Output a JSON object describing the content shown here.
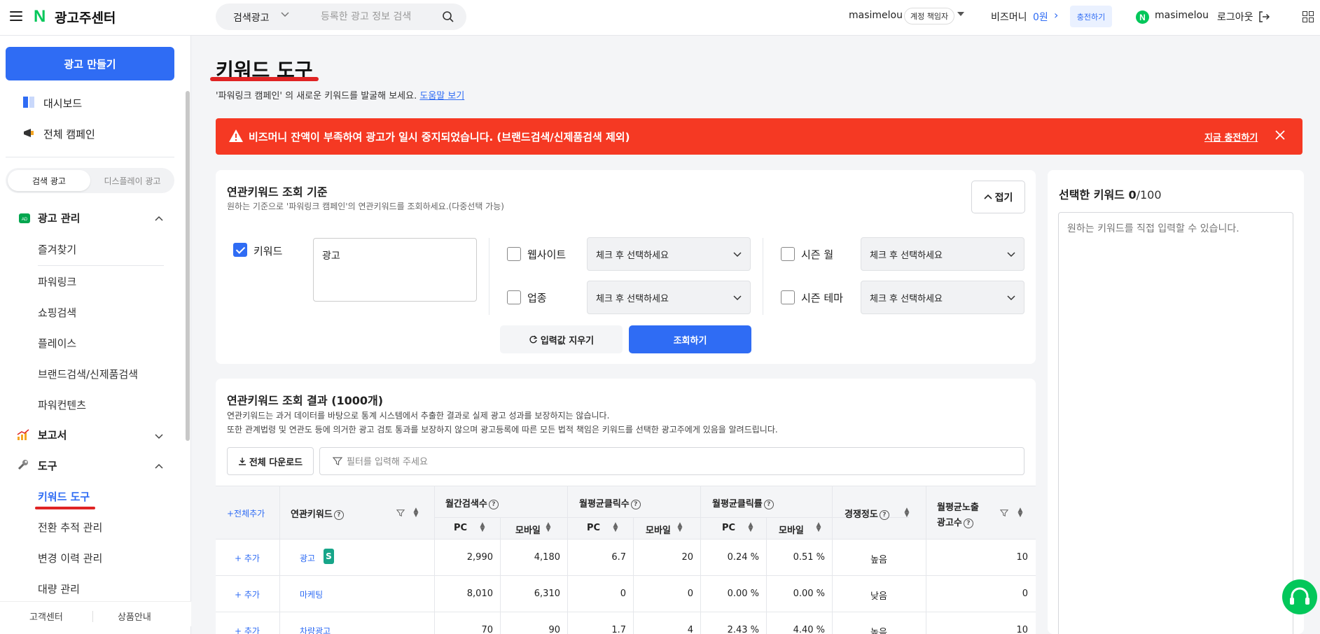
{
  "header": {
    "logo": "N",
    "app_title": "광고주센터",
    "search_type": "검색광고",
    "search_placeholder": "등록한 광고 정보 검색",
    "user_id": "masimelou",
    "role_badge": "계정 책임자",
    "bizmoney_label": "비즈머니",
    "bizmoney_value": "0원",
    "charge_label": "충전하기",
    "naver_user": "masimelou",
    "logout_label": "로그아웃"
  },
  "sidebar": {
    "create_ad": "광고 만들기",
    "top_items": [
      {
        "label": "대시보드",
        "icon": "dashboard-icon"
      },
      {
        "label": "전체 캠페인",
        "icon": "megaphone-icon"
      }
    ],
    "segment": [
      "검색 광고",
      "디스플레이 광고"
    ],
    "ad_manage": {
      "label": "광고 관리",
      "items": [
        "즐겨찾기",
        "파워링크",
        "쇼핑검색",
        "플레이스",
        "브랜드검색/신제품검색",
        "파워컨텐츠"
      ]
    },
    "report": "보고서",
    "tools": {
      "label": "도구",
      "items": [
        "키워드 도구",
        "전환 추적 관리",
        "변경 이력 관리",
        "대량 관리"
      ],
      "active": "키워드 도구"
    },
    "footer": [
      "고객센터",
      "상품안내"
    ]
  },
  "page": {
    "title": "키워드 도구",
    "desc": "'파워링크 캠페인' 의 새로운 키워드를 발굴해 보세요.",
    "help_link": "도움말 보기"
  },
  "alert": {
    "message": "비즈머니 잔액이 부족하여 광고가 일시 중지되었습니다. (브랜드검색/신제품검색 제외)",
    "link": "지금 충전하기",
    "color": "#f53923"
  },
  "criteria": {
    "title": "연관키워드 조회 기준",
    "subtitle": "원하는 기준으로 '파워링크 캠페인'의 연관키워드를 조회하세요.(다중선택 가능)",
    "fold_label": "접기",
    "keyword_label": "키워드",
    "keyword_value": "광고",
    "website_label": "웹사이트",
    "industry_label": "업종",
    "season_month_label": "시즌 월",
    "season_theme_label": "시즌 테마",
    "select_placeholder": "체크 후 선택하세요",
    "clear_label": "입력값 지우기",
    "search_label": "조회하기"
  },
  "selected": {
    "title": "선택한 키워드",
    "count": "0",
    "max": "/100",
    "placeholder": "원하는 키워드를 직접 입력할 수 있습니다."
  },
  "results": {
    "title": "연관키워드 조회 결과 (1000개)",
    "note1": "연관키워드는 과거 데이터를 바탕으로 통계 시스템에서 추출한 결과로 실제 광고 성과를 보장하지는 않습니다.",
    "note2": "또한 관계법령 및 연관도 등에 의거한 광고 검토 통과를 보장하지 않으며 광고등록에 따른 모든 법적 책임은 키워드를 선택한 광고주에게 있음을 알려드립니다.",
    "download_label": "전체 다운로드",
    "filter_placeholder": "필터를 입력해 주세요",
    "headers": {
      "add_all": "+전체추가",
      "keyword": "연관키워드",
      "monthly_search": "월간검색수",
      "avg_clicks": "월평균클릭수",
      "avg_ctr": "월평균클릭률",
      "competition": "경쟁정도",
      "ad_count_1": "월평균노출",
      "ad_count_2": "광고수",
      "pc": "PC",
      "mobile": "모바일"
    },
    "add_label": "+ 추가",
    "rows": [
      {
        "keyword": "광고",
        "badge": "S",
        "pc_search": "2,990",
        "mo_search": "4,180",
        "pc_click": "6.7",
        "mo_click": "20",
        "pc_ctr": "0.24 %",
        "mo_ctr": "0.51 %",
        "comp": "높음",
        "ads": "10"
      },
      {
        "keyword": "마케팅",
        "badge": "",
        "pc_search": "8,010",
        "mo_search": "6,310",
        "pc_click": "0",
        "mo_click": "0",
        "pc_ctr": "0.00 %",
        "mo_ctr": "0.00 %",
        "comp": "낮음",
        "ads": "0"
      },
      {
        "keyword": "차량광고",
        "badge": "",
        "pc_search": "70",
        "mo_search": "90",
        "pc_click": "1.7",
        "mo_click": "4",
        "pc_ctr": "2.43 %",
        "mo_ctr": "4.40 %",
        "comp": "높음",
        "ads": "10"
      }
    ]
  }
}
